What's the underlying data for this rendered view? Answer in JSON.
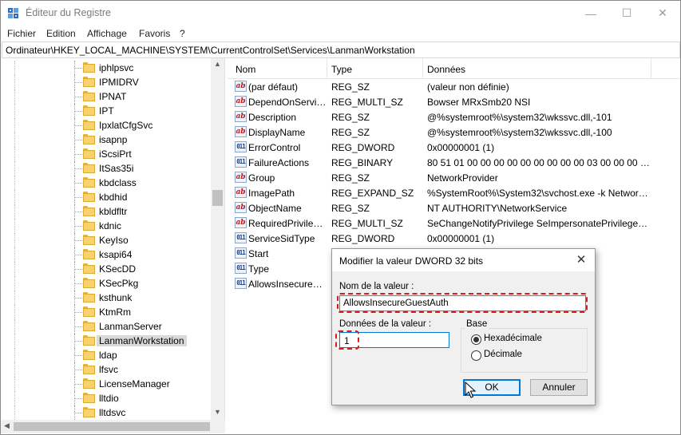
{
  "window": {
    "title": "Éditeur du Registre",
    "minimize_glyph": "—",
    "maximize_glyph": "☐",
    "close_glyph": "✕"
  },
  "menu": {
    "items": [
      "Fichier",
      "Edition",
      "Affichage",
      "Favoris",
      "?"
    ]
  },
  "address": "Ordinateur\\HKEY_LOCAL_MACHINE\\SYSTEM\\CurrentControlSet\\Services\\LanmanWorkstation",
  "tree": {
    "items": [
      {
        "label": "iphlpsvc"
      },
      {
        "label": "IPMIDRV"
      },
      {
        "label": "IPNAT"
      },
      {
        "label": "IPT"
      },
      {
        "label": "IpxlatCfgSvc"
      },
      {
        "label": "isapnp"
      },
      {
        "label": "iScsiPrt"
      },
      {
        "label": "ItSas35i"
      },
      {
        "label": "kbdclass"
      },
      {
        "label": "kbdhid"
      },
      {
        "label": "kbldfltr"
      },
      {
        "label": "kdnic"
      },
      {
        "label": "KeyIso"
      },
      {
        "label": "ksapi64"
      },
      {
        "label": "KSecDD"
      },
      {
        "label": "KSecPkg"
      },
      {
        "label": "ksthunk"
      },
      {
        "label": "KtmRm"
      },
      {
        "label": "LanmanServer"
      },
      {
        "label": "LanmanWorkstation",
        "selected": true
      },
      {
        "label": "ldap"
      },
      {
        "label": "lfsvc"
      },
      {
        "label": "LicenseManager"
      },
      {
        "label": "lltdio"
      },
      {
        "label": "lltdsvc"
      }
    ]
  },
  "list": {
    "headers": {
      "name": "Nom",
      "type": "Type",
      "data": "Données"
    },
    "rows": [
      {
        "icon": "sz",
        "name": "(par défaut)",
        "type": "REG_SZ",
        "data": "(valeur non définie)"
      },
      {
        "icon": "sz",
        "name": "DependOnService",
        "type": "REG_MULTI_SZ",
        "data": "Bowser MRxSmb20 NSI"
      },
      {
        "icon": "sz",
        "name": "Description",
        "type": "REG_SZ",
        "data": "@%systemroot%\\system32\\wkssvc.dll,-101"
      },
      {
        "icon": "sz",
        "name": "DisplayName",
        "type": "REG_SZ",
        "data": "@%systemroot%\\system32\\wkssvc.dll,-100"
      },
      {
        "icon": "bin",
        "name": "ErrorControl",
        "type": "REG_DWORD",
        "data": "0x00000001 (1)"
      },
      {
        "icon": "bin",
        "name": "FailureActions",
        "type": "REG_BINARY",
        "data": "80 51 01 00 00 00 00 00 00 00 00 00 03 00 00 00 14 00..."
      },
      {
        "icon": "sz",
        "name": "Group",
        "type": "REG_SZ",
        "data": "NetworkProvider"
      },
      {
        "icon": "sz",
        "name": "ImagePath",
        "type": "REG_EXPAND_SZ",
        "data": "%SystemRoot%\\System32\\svchost.exe -k Network..."
      },
      {
        "icon": "sz",
        "name": "ObjectName",
        "type": "REG_SZ",
        "data": "NT AUTHORITY\\NetworkService"
      },
      {
        "icon": "sz",
        "name": "RequiredPrivileg...",
        "type": "REG_MULTI_SZ",
        "data": "SeChangeNotifyPrivilege SeImpersonatePrivilege S..."
      },
      {
        "icon": "bin",
        "name": "ServiceSidType",
        "type": "REG_DWORD",
        "data": "0x00000001 (1)"
      },
      {
        "icon": "bin",
        "name": "Start",
        "type": "",
        "data": ""
      },
      {
        "icon": "bin",
        "name": "Type",
        "type": "",
        "data": ""
      },
      {
        "icon": "bin",
        "name": "AllowsInsecureG...",
        "type": "",
        "data": ""
      }
    ]
  },
  "dialog": {
    "title": "Modifier la valeur DWORD 32 bits",
    "close_glyph": "✕",
    "name_label": "Nom de la valeur :",
    "name_value": "AllowsInsecureGuestAuth",
    "data_label": "Données de la valeur :",
    "data_value": "1",
    "base_label": "Base",
    "base_options": [
      {
        "label": "Hexadécimale",
        "checked": true
      },
      {
        "label": "Décimale",
        "checked": false
      }
    ],
    "ok_label": "OK",
    "cancel_label": "Annuler"
  },
  "colors": {
    "highlight_dashes": "#d81b1b",
    "focus_blue": "#0078d7",
    "folder_yellow": "#f7d36f"
  }
}
